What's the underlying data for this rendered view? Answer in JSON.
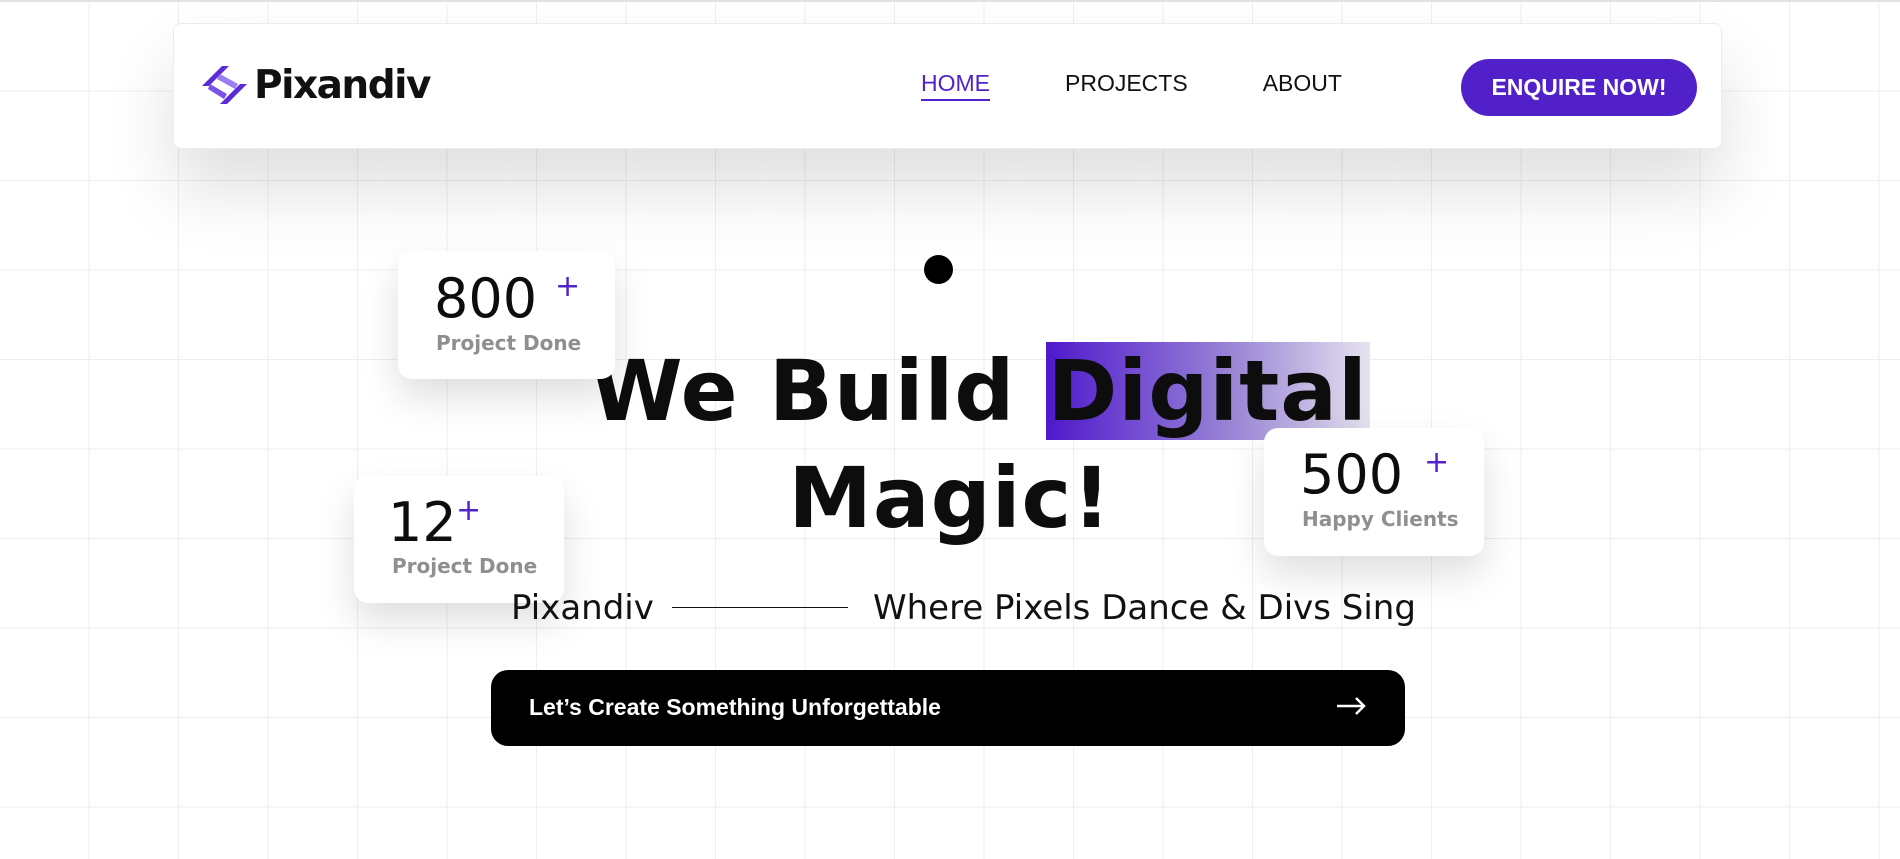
{
  "brand": {
    "name": "Pixandiv",
    "accent_color": "#5120c8"
  },
  "nav": {
    "items": [
      {
        "label": "HOME",
        "active": true
      },
      {
        "label": "PROJECTS",
        "active": false
      },
      {
        "label": "ABOUT",
        "active": false
      }
    ],
    "cta_label": "ENQUIRE NOW!"
  },
  "hero": {
    "headline_part1": "We Build ",
    "headline_highlight": "Digital",
    "headline_line2": "Magic!",
    "tagline_brand": "Pixandiv",
    "tagline_text": "Where Pixels Dance & Divs Sing",
    "cta_label": "Let’s Create Something Unforgettable",
    "cta_icon": "arrow-right-icon"
  },
  "stats": [
    {
      "value": "800",
      "suffix": "+",
      "label": "Project Done"
    },
    {
      "value": "12",
      "suffix": "+",
      "label": "Project Done"
    },
    {
      "value": "500",
      "suffix": "+",
      "label": "Happy Clients"
    }
  ]
}
